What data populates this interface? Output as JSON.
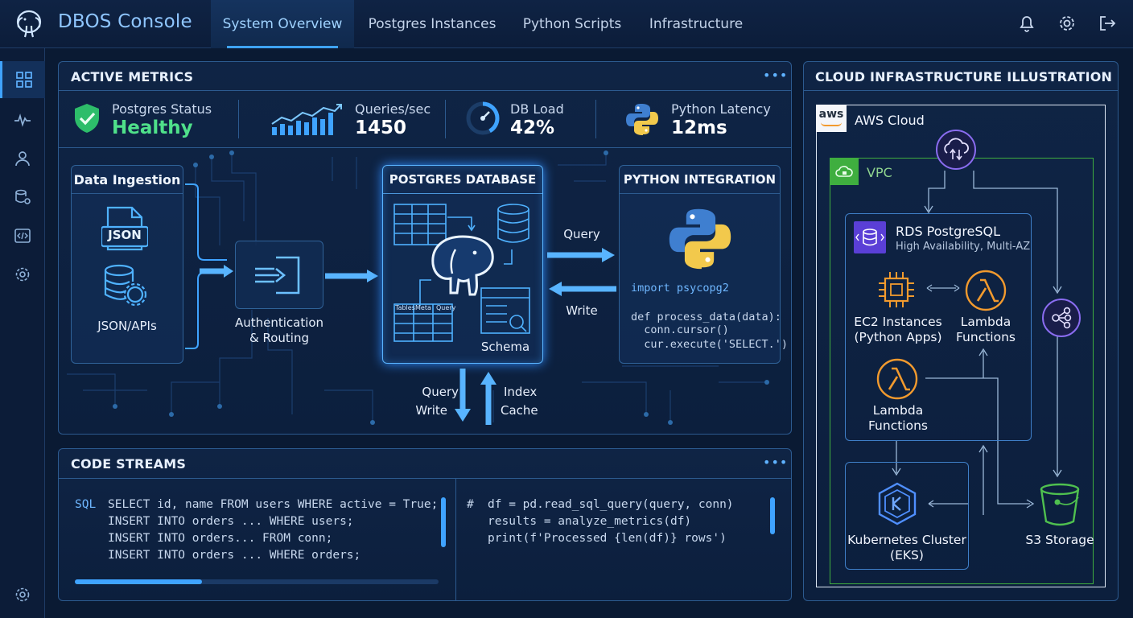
{
  "app": {
    "title": "DBOS Console",
    "tabs": [
      "System Overview",
      "Postgres Instances",
      "Python Scripts",
      "Infrastructure"
    ],
    "active_tab": "System Overview"
  },
  "metrics": {
    "title": "ACTIVE METRICS",
    "items": [
      {
        "label": "Postgres Status",
        "value": "Healthy"
      },
      {
        "label": "Queries/sec",
        "value": "1450"
      },
      {
        "label": "DB Load",
        "value": "42%"
      },
      {
        "label": "Python Latency",
        "value": "12ms"
      }
    ],
    "db_load_fraction": 0.42
  },
  "flow": {
    "ingestion": {
      "title": "Data Ingestion",
      "json_badge": "JSON",
      "caption": "JSON/APIs"
    },
    "auth": {
      "caption_line1": "Authentication",
      "caption_line2": "& Routing"
    },
    "postgres": {
      "title": "POSTGRES DATABASE",
      "schema_label": "Schema",
      "mini_headers": [
        "Tables",
        "Meta",
        "Query"
      ]
    },
    "python": {
      "title": "PYTHON INTEGRATION",
      "code": [
        "import psycopg2",
        "",
        "def process_data(data):",
        "  conn.cursor()",
        "  cur.execute('SELECT.')"
      ]
    },
    "arrow_query": "Query",
    "arrow_write": "Write",
    "down_label_1": "Query",
    "down_label_2": "Write",
    "up_label_1": "Index",
    "up_label_2": "Cache"
  },
  "code_streams": {
    "title": "CODE STREAMS",
    "sql_prefix": "SQL",
    "sql_lines": [
      "SELECT id, name FROM users WHERE active = True;",
      "INSERT INTO orders ... WHERE users;",
      "INSERT INTO orders... FROM conn;",
      "INSERT INTO orders ... WHERE orders;"
    ],
    "py_prefix": "#",
    "py_lines": [
      "df = pd.read_sql_query(query, conn)",
      "results = analyze_metrics(df)",
      "print(f'Processed {len(df)} rows')"
    ],
    "progress_fraction": 0.35
  },
  "infra": {
    "title": "CLOUD INFRASTRUCTURE ILLUSTRATION",
    "aws_badge": "aws",
    "aws_label": "AWS Cloud",
    "vpc_label": "VPC",
    "rds_title": "RDS PostgreSQL",
    "rds_sub": "High Availability, Multi-AZ",
    "ec2_line1": "EC2 Instances",
    "ec2_line2": "(Python Apps)",
    "lambda1_line1": "Lambda",
    "lambda1_line2": "Functions",
    "lambda2_line1": "Lambda",
    "lambda2_line2": "Functions",
    "k8s_line1": "Kubernetes Cluster",
    "k8s_line2": "(EKS)",
    "s3_label": "S3 Storage"
  },
  "colors": {
    "accent": "#3fa3ff",
    "healthy": "#4fe08a",
    "aws_orange": "#f29a2e",
    "vpc_green": "#3fae3f",
    "rds_purple": "#8a5cf0"
  }
}
